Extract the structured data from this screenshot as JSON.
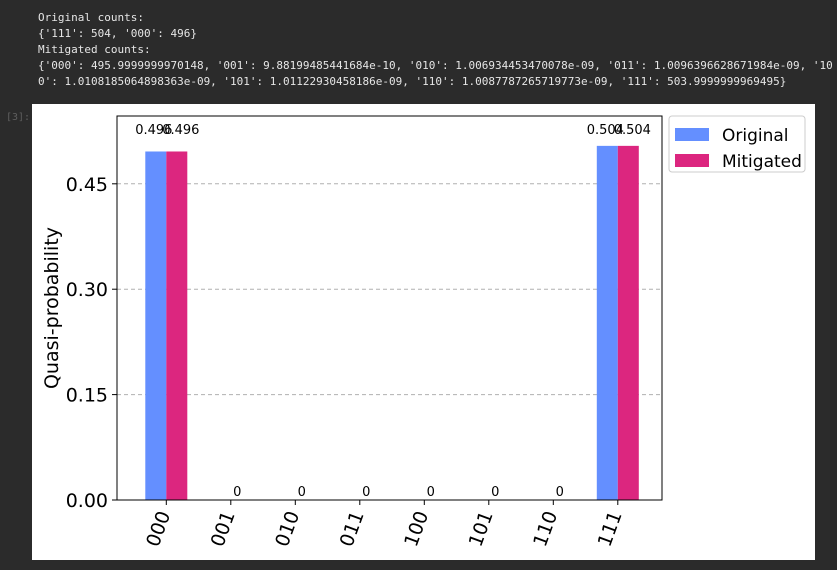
{
  "notebook": {
    "output_lines": [
      "Original counts:",
      "{'111': 504, '000': 496}",
      "Mitigated counts:",
      "{'000': 495.9999999970148, '001': 9.88199485441684e-10, '010': 1.006934453470078e-09, '011': 1.0096396628671984e-09, '10",
      "0': 1.0108185064898363e-09, '101': 1.01122930458186e-09, '110': 1.0087787265719773e-09, '111': 503.9999999969495}"
    ],
    "cell_prompt": "[3]:"
  },
  "chart_data": {
    "type": "bar",
    "categories": [
      "000",
      "001",
      "010",
      "011",
      "100",
      "101",
      "110",
      "111"
    ],
    "series": [
      {
        "name": "Original",
        "color": "#648fff",
        "values": [
          0.496,
          0,
          0,
          0,
          0,
          0,
          0,
          0.504
        ],
        "labels": [
          "0.496",
          "",
          "",
          "",
          "",
          "",
          "",
          "0.504"
        ]
      },
      {
        "name": "Mitigated",
        "color": "#dc267f",
        "values": [
          0.496,
          0,
          0,
          0,
          0,
          0,
          0,
          0.504
        ],
        "labels": [
          "0.496",
          "0",
          "0",
          "0",
          "0",
          "0",
          "0",
          "0.504"
        ]
      }
    ],
    "ylabel": "Quasi-probability",
    "ylim": [
      0,
      0.5465
    ],
    "yticks": [
      "0.00",
      "0.15",
      "0.30",
      "0.45"
    ],
    "ytick_values": [
      0,
      0.15,
      0.3,
      0.45
    ],
    "grid": true,
    "legend": "outside-top-right"
  }
}
